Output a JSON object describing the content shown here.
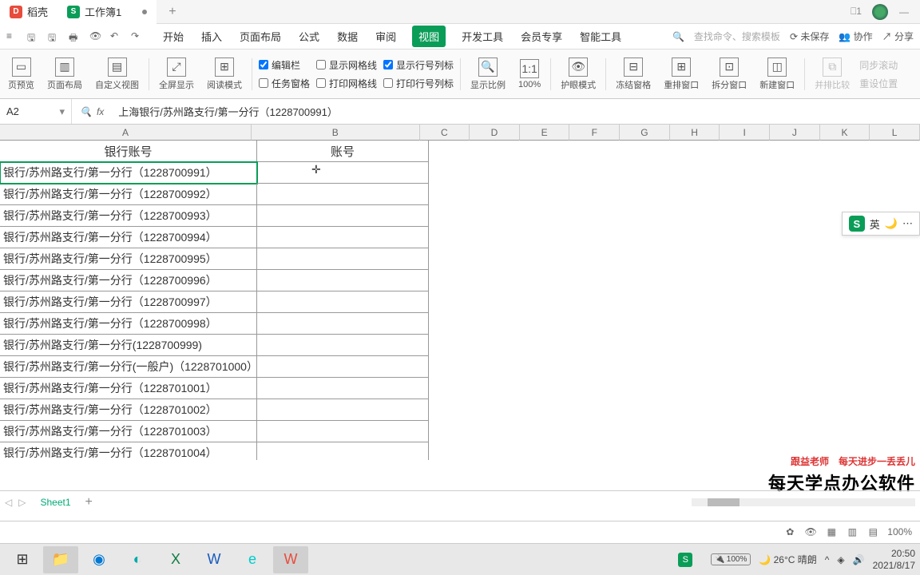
{
  "tabs": {
    "dao": "稻壳",
    "workbook": "工作簿1"
  },
  "menu": {
    "items": [
      "开始",
      "插入",
      "页面布局",
      "公式",
      "数据",
      "审阅",
      "视图",
      "开发工具",
      "会员专享",
      "智能工具"
    ],
    "active_index": 6,
    "search": "查找命令、搜索模板",
    "unsaved": "未保存",
    "collab": "协作",
    "share": "分享"
  },
  "ribbon": {
    "btns": [
      "页预览",
      "页面布局",
      "自定义视图",
      "全屏显示",
      "阅读模式"
    ],
    "checks1": [
      {
        "label": "编辑栏",
        "checked": true
      },
      {
        "label": "任务窗格",
        "checked": false
      }
    ],
    "checks2": [
      {
        "label": "显示网格线",
        "checked": false
      },
      {
        "label": "打印网格线",
        "checked": false
      }
    ],
    "checks3": [
      {
        "label": "显示行号列标",
        "checked": true
      },
      {
        "label": "打印行号列标",
        "checked": false
      }
    ],
    "btns2": [
      "显示比例",
      "100%",
      "护眼模式",
      "冻结窗格",
      "重排窗口",
      "拆分窗口",
      "新建窗口"
    ],
    "btns3": [
      "并排比较",
      "同步滚动",
      "重设位置"
    ]
  },
  "namebox": "A2",
  "formula": "上海银行/苏州路支行/第一分行（1228700991）",
  "cols": [
    "A",
    "B",
    "C",
    "D",
    "E",
    "F",
    "G",
    "H",
    "I",
    "J",
    "K",
    "L"
  ],
  "headers": {
    "a": "银行账号",
    "b": "账号"
  },
  "rows": [
    "银行/苏州路支行/第一分行（1228700991）",
    "银行/苏州路支行/第一分行（1228700992）",
    "银行/苏州路支行/第一分行（1228700993）",
    "银行/苏州路支行/第一分行（1228700994）",
    "银行/苏州路支行/第一分行（1228700995）",
    "银行/苏州路支行/第一分行（1228700996）",
    "银行/苏州路支行/第一分行（1228700997）",
    "银行/苏州路支行/第一分行（1228700998）",
    "银行/苏州路支行/第一分行(1228700999)",
    "银行/苏州路支行/第一分行(一般户)（1228701000）",
    "银行/苏州路支行/第一分行（1228701001）",
    "银行/苏州路支行/第一分行（1228701002）",
    "银行/苏州路支行/第一分行（1228701003）",
    "银行/苏州路支行/第一分行（1228701004）"
  ],
  "ime": {
    "lang": "英"
  },
  "sheet": "Sheet1",
  "promo": {
    "line1": "跟益老师　每天进步一丢丢儿",
    "line2": "每天学点办公软件"
  },
  "statusbar": {
    "zoom": "100%"
  },
  "taskbar": {
    "battery": "100%",
    "weather": "26°C 晴朗",
    "time": "20:50",
    "date": "2021/8/17"
  }
}
